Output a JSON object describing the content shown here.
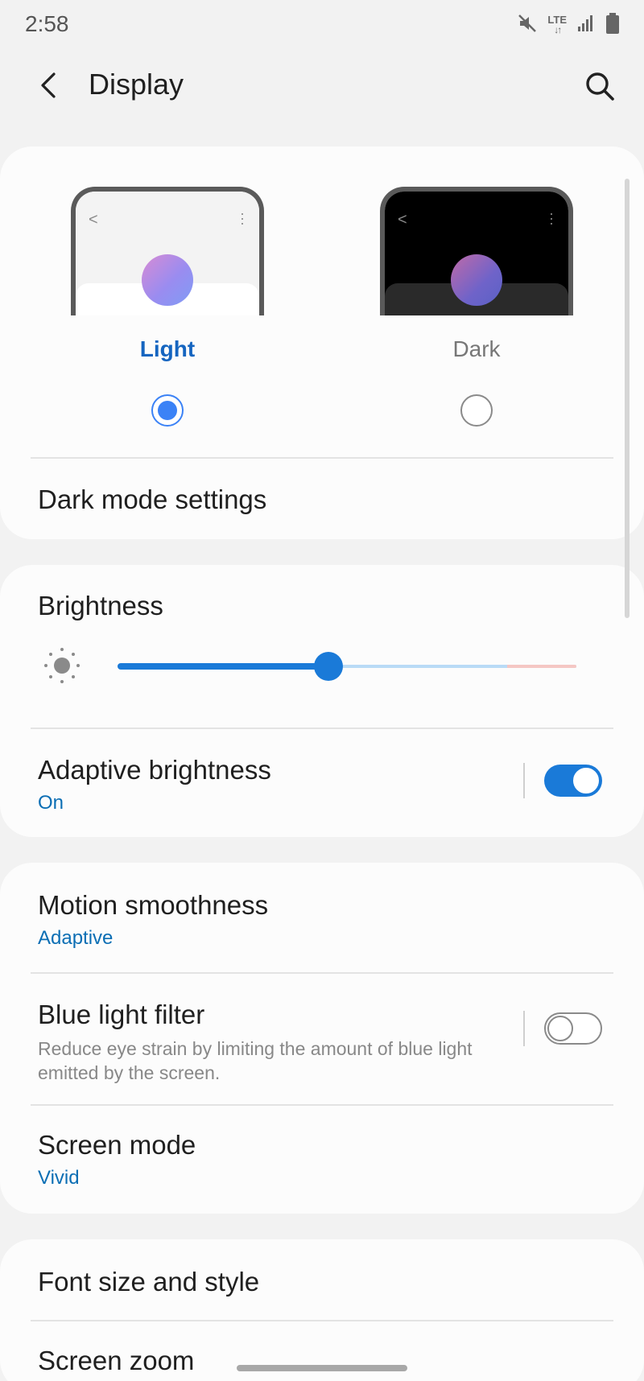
{
  "status_bar": {
    "time": "2:58",
    "network": "LTE",
    "icons": [
      "mute-icon",
      "lte-icon",
      "signal-icon",
      "battery-icon"
    ]
  },
  "app_bar": {
    "title": "Display",
    "back_icon": "back-arrow-icon",
    "search_icon": "search-icon"
  },
  "theme": {
    "options": [
      {
        "label": "Light",
        "selected": true
      },
      {
        "label": "Dark",
        "selected": false
      }
    ],
    "dark_mode_settings": "Dark mode settings"
  },
  "brightness": {
    "title": "Brightness",
    "level": 0.46,
    "icon": "sun-icon"
  },
  "adaptive_brightness": {
    "title": "Adaptive brightness",
    "status": "On",
    "enabled": true
  },
  "motion_smoothness": {
    "title": "Motion smoothness",
    "value": "Adaptive"
  },
  "blue_light_filter": {
    "title": "Blue light filter",
    "description": "Reduce eye strain by limiting the amount of blue light emitted by the screen.",
    "enabled": false
  },
  "screen_mode": {
    "title": "Screen mode",
    "value": "Vivid"
  },
  "font": {
    "title": "Font size and style",
    "next_row_partial": "Screen zoom"
  },
  "colors": {
    "accent": "#1a7ad8",
    "label_selected": "#1565c0",
    "subtext": "#0b6eb4"
  }
}
